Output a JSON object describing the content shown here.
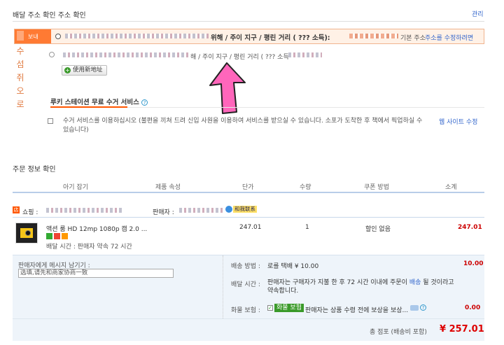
{
  "address": {
    "title": "배달 주소 확인 주소 확인",
    "manage": "관리",
    "send_to_label": "보내",
    "selected_addr": "위해 / 주이 지구 / 평린 거리 ( ??? 소득):",
    "default_text": "기본 주소",
    "edit_text": "주소를 수정하려면",
    "alt_addr": "해 / 주이 지구 / 평린 거리 ( ??? 소득",
    "use_new_label": "使用新地址",
    "left_vertical": [
      "수",
      "섬",
      "쥐",
      "오",
      "로"
    ]
  },
  "pickup": {
    "title": "루키 스테이션 무료 수거 서비스",
    "desc_line1": "수거 서비스를 이용하십시오 (불편을 끼쳐 드려 신입 사원을 이용하여 서비스를 받으실 수 있습니다. 소포가 도착한 후 책에서 픽업하실 수",
    "desc_line2": "있습니다)",
    "link": "웹 사이트 수정"
  },
  "order": {
    "title": "주문 정보 확인",
    "columns": [
      "아기 잡기",
      "제품 속성",
      "단가",
      "수량",
      "쿠폰 방법",
      "소계"
    ],
    "shop_label": "쇼핑 :",
    "seller_label": "판매자 :",
    "contact_label": "和我联系",
    "item": {
      "name": "액션 룸 HD 12mp 1080p 캠 2.0 ...",
      "ship_time": "배달 시간 : 판매자 약속 72 시간",
      "price": "247.01",
      "qty": "1",
      "coupon": "할인 없음",
      "subtotal": "247.01"
    },
    "message_label": "판매자에게 메시지 남기기 :",
    "message_value": "选填,请先和商家协商一致",
    "ship_method_label": "배송 방법 :",
    "ship_method_value": "로를 택배 ¥ 10.00",
    "ship_cost": "10.00",
    "delivery_label": "배달 시간 :",
    "delivery_value_1": "판매자는 구매자가 지불 한 후 72 시간 이내에 주문이",
    "delivery_link": "배송",
    "delivery_value_2": "될 것이라고",
    "delivery_value_3": "약속합니다.",
    "insurance_label": "화물 보험 :",
    "insurance_tag": "화물 보험",
    "insurance_value": "판매자는 상품 수령 전에 보상을 보상...",
    "insurance_cost": "0.00",
    "total_label": "총 점포 (배송비 포함)",
    "total_value": "¥ 257.01"
  },
  "colors": {
    "accent": "#ff5500",
    "price_red": "#cc0000",
    "arrow_pink": "#ff66bb",
    "link": "#3366cc"
  }
}
